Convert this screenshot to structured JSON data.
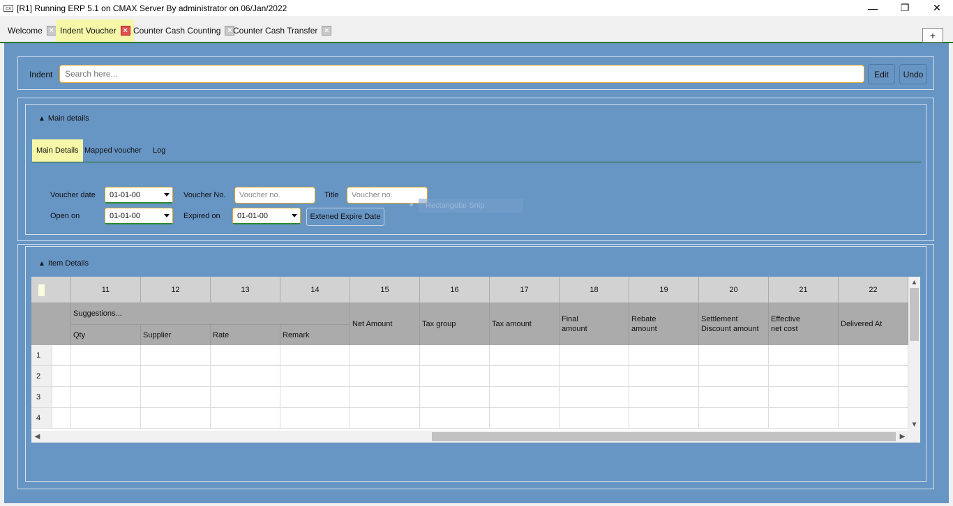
{
  "window": {
    "icon_text": "cx",
    "title": "[R1] Running ERP 5.1 on CMAX Server By administrator on 06/Jan/2022",
    "minimize": "—",
    "restore": "❐",
    "close": "✕"
  },
  "tabs": [
    {
      "label": "Welcome",
      "active": false
    },
    {
      "label": "Indent Voucher",
      "active": true
    },
    {
      "label": "Counter Cash Counting",
      "active": false
    },
    {
      "label": "Counter Cash Transfer",
      "active": false
    }
  ],
  "tab_close_glyph": "×",
  "plus_label": "+",
  "search": {
    "label": "Indent",
    "placeholder": "Search here...",
    "edit_label": "Edit",
    "undo_label": "Undo"
  },
  "main_details": {
    "toggle_glyph": "▲",
    "title": "Main details",
    "subtabs": [
      "Main Details",
      "Mapped voucher",
      "Log"
    ],
    "voucher_date_label": "Voucher date",
    "voucher_date_value": "01-01-00",
    "voucher_no_label": "Voucher No.",
    "voucher_no_placeholder": "Voucher no.",
    "title_label": "Title",
    "title_placeholder": "Voucher no.",
    "open_on_label": "Open on",
    "open_on_value": "01-01-00",
    "expired_on_label": "Expired on",
    "expired_on_value": "01-01-00",
    "extend_button": "Extened Expire Date",
    "ghost_text": "Rectangular Snip"
  },
  "item_details": {
    "toggle_glyph": "▲",
    "title": "Item Details",
    "column_numbers": [
      "11",
      "12",
      "13",
      "14",
      "15",
      "16",
      "17",
      "18",
      "19",
      "20",
      "21",
      "22"
    ],
    "group_header": "Suggestions...",
    "sub_headers": [
      "Qty",
      "Supplier",
      "Rate",
      "Remark"
    ],
    "col_headers": [
      {
        "line1": "Net Amount",
        "line2": ""
      },
      {
        "line1": "Tax group",
        "line2": ""
      },
      {
        "line1": "Tax amount",
        "line2": ""
      },
      {
        "line1": "Final",
        "line2": "amount"
      },
      {
        "line1": "Rebate",
        "line2": "amount"
      },
      {
        "line1": "Settlement",
        "line2": "Discount amount"
      },
      {
        "line1": "Effective",
        "line2": "net cost"
      },
      {
        "line1": "Delivered At",
        "line2": ""
      }
    ],
    "rows": [
      "1",
      "2",
      "3",
      "4"
    ],
    "scroll_up": "▲",
    "scroll_down": "▼",
    "scroll_left": "◀",
    "scroll_right": "▶"
  },
  "colors": {
    "workspace": "#6795c4",
    "active_tab": "#f6f7a8",
    "accent_border": "#e8a81e",
    "divider_green": "#2b7a2b"
  }
}
